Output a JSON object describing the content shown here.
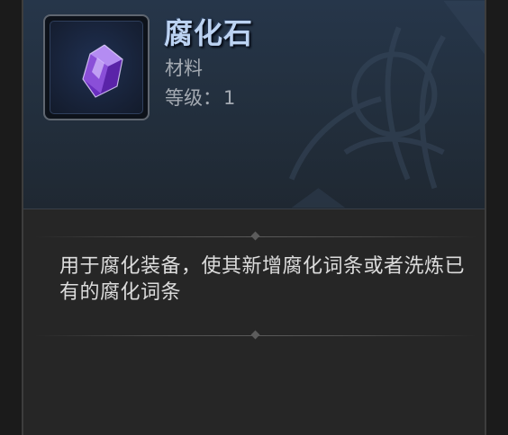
{
  "item": {
    "name": "腐化石",
    "type": "材料",
    "level_label": "等级：",
    "level_value": "1",
    "icon": "purple-crystal-icon",
    "description": "用于腐化装备，使其新增腐化词条或者洗炼已有的腐化词条"
  },
  "colors": {
    "name": "#bcd3f2",
    "meta": "#a4aab2",
    "description": "#dcdcdc",
    "header_bg": "#26364a",
    "panel_bg": "#262626",
    "gem": "#8a4fd8"
  }
}
